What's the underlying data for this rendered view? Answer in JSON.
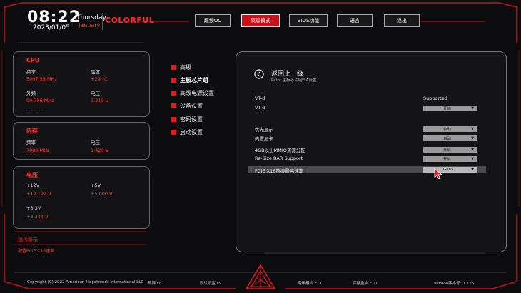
{
  "clock": {
    "time": "08:22",
    "day": "Thursday",
    "month": "January",
    "date": "2023/01/05"
  },
  "brand": {
    "name": "COLORFUL"
  },
  "top_tabs": [
    {
      "label": "超频OC",
      "active": false
    },
    {
      "label": "高级模式",
      "active": true
    },
    {
      "label": "BIOS功能",
      "active": false
    },
    {
      "label": "语言",
      "active": false
    },
    {
      "label": "退出",
      "active": false
    }
  ],
  "cpu": {
    "title": "CPU",
    "freq_label": "频率",
    "freq_value": "5007.55 MHz",
    "temp_label": "温度",
    "temp_value": "+29 °C",
    "ext_label": "外频",
    "ext_value": "99.756 MHz",
    "volt_label": "电压",
    "volt_value": "1.219 V",
    "dash": "- - - -"
  },
  "memory": {
    "title": "内存",
    "freq_label": "频率",
    "freq_value": "7880 MHz",
    "volt_label": "电压",
    "volt_value": "1.420 V",
    "dash": "- - - -"
  },
  "voltage": {
    "title": "电压",
    "v12_label": "+12V",
    "v12_value": "+12.192 V",
    "v5_label": "+5V",
    "v5_value": "+5.000 V",
    "v33_label": "+3.3V",
    "v33_value": "+3.344 V"
  },
  "hint": {
    "title": "操作提示",
    "text": "配置PCIE X16速率"
  },
  "menu": [
    {
      "label": "高级",
      "active": false
    },
    {
      "label": "主板芯片组",
      "active": true
    },
    {
      "label": "高级电源设置",
      "active": false
    },
    {
      "label": "设备设置",
      "active": false
    },
    {
      "label": "密码设置",
      "active": false
    },
    {
      "label": "启动设置",
      "active": false
    }
  ],
  "main": {
    "back_label": "返回上一级",
    "path": "Path: 主板芯片组\\SA设置",
    "rows": [
      {
        "label": "VT-d",
        "value": "Supported",
        "type": "text"
      },
      {
        "label": "VT-d",
        "value": "开启",
        "type": "dropdown"
      },
      {
        "label": "优先显示",
        "value": "自动",
        "type": "dropdown"
      },
      {
        "label": "内置显卡",
        "value": "自动",
        "type": "dropdown"
      },
      {
        "label": "4GB以上MMIO资源分配",
        "value": "开启",
        "type": "dropdown"
      },
      {
        "label": "Re-Size BAR Support",
        "value": "开启",
        "type": "dropdown"
      },
      {
        "label": "PCIE X16链接最高速率",
        "value": "Gen5",
        "type": "dropdown",
        "selected": true
      }
    ]
  },
  "footer": {
    "copyright": "Copyright (C) 2022 American Megatrends International LLC",
    "screenshot": "截屏 F8",
    "defaults": "默认设置 F9",
    "advanced": "高级模式 F11",
    "save_reset": "保存重启 F10",
    "version": "Version版本号: 1.126"
  },
  "colors": {
    "accent": "#e11a22",
    "text_red": "#ff3b30",
    "panel_border": "#777777",
    "background": "#0c0c0e"
  }
}
